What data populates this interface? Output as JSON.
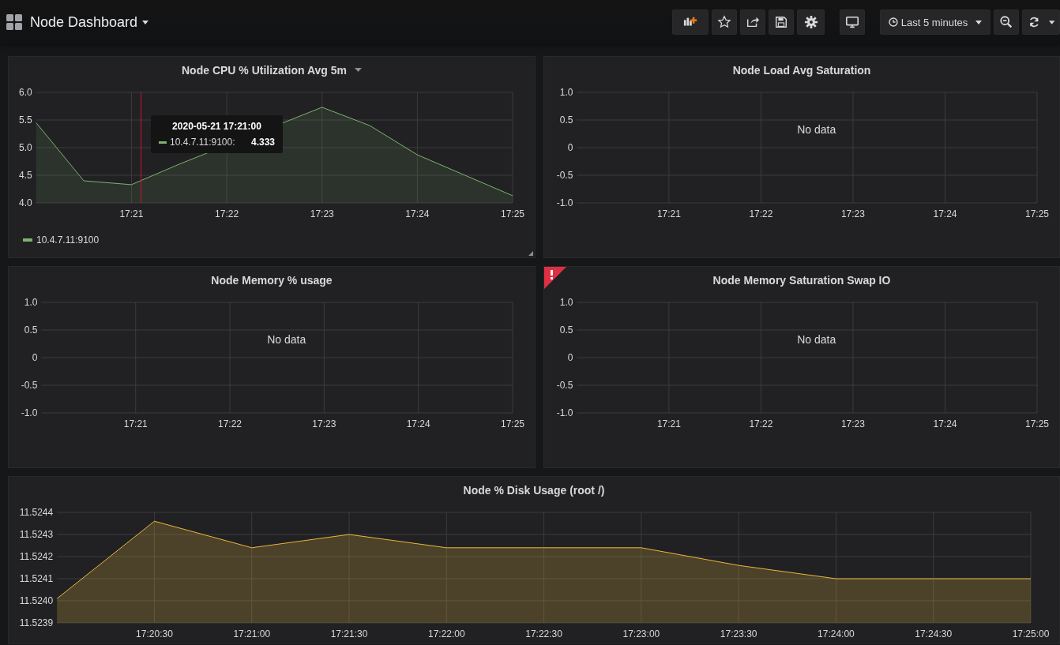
{
  "header": {
    "title": "Node Dashboard",
    "toolbar": [
      {
        "kind": "add-panel"
      },
      {
        "kind": "star"
      },
      {
        "kind": "share"
      },
      {
        "kind": "save"
      },
      {
        "kind": "settings"
      },
      {
        "kind": "tv"
      },
      {
        "kind": "time-picker",
        "label": "Last 5 minutes"
      },
      {
        "kind": "zoom-out"
      },
      {
        "kind": "refresh"
      }
    ]
  },
  "panels": [
    {
      "title": "Node CPU % Utilization Avg 5m",
      "hovered": true,
      "alert": false,
      "tooltip": {
        "time": "2020-05-21 17:21:00",
        "series": "10.4.7.11:9100:",
        "value": "4.333"
      },
      "chart_data": {
        "type": "area",
        "categories": [
          null,
          null,
          "17:21",
          null,
          "17:22",
          null,
          "17:23",
          null,
          "17:24",
          null,
          "17:25"
        ],
        "ylim": [
          4,
          6
        ],
        "yticks": [
          {
            "value": 6,
            "label": "6.0"
          },
          {
            "value": 5.5,
            "label": "5.5"
          },
          {
            "value": 5,
            "label": "5.0"
          },
          {
            "value": 4.5,
            "label": "4.5"
          },
          {
            "value": 4,
            "label": "4.0"
          }
        ],
        "series": [
          {
            "name": "10.4.7.11:9100",
            "color": "#7eb26d",
            "values": [
              5.45,
              4.4,
              4.33,
              4.7,
              null,
              null,
              5.73,
              5.4,
              4.87,
              4.5,
              4.13
            ]
          }
        ],
        "grid": true
      }
    },
    {
      "title": "Node Load Avg Saturation",
      "hovered": false,
      "alert": false,
      "no_data": "No data",
      "chart_data": {
        "type": "line",
        "grid": true,
        "categories": [
          null,
          null,
          "17:21",
          null,
          "17:22",
          null,
          "17:23",
          null,
          "17:24",
          null,
          "17:25"
        ],
        "ylim": [
          -1,
          1
        ],
        "yticks": [
          {
            "value": 1,
            "label": "1.0"
          },
          {
            "value": 0.5,
            "label": "0.5"
          },
          {
            "value": 0,
            "label": "0"
          },
          {
            "value": -0.5,
            "label": "-0.5"
          },
          {
            "value": -1,
            "label": "-1.0"
          }
        ]
      }
    },
    {
      "title": "Node Memory % usage",
      "hovered": false,
      "alert": false,
      "no_data": "No data",
      "chart_data": {
        "type": "line",
        "grid": true,
        "categories": [
          null,
          null,
          "17:21",
          null,
          "17:22",
          null,
          "17:23",
          null,
          "17:24",
          null,
          "17:25"
        ],
        "ylim": [
          -1,
          1
        ],
        "yticks": [
          {
            "value": 1,
            "label": "1.0"
          },
          {
            "value": 0.5,
            "label": "0.5"
          },
          {
            "value": 0,
            "label": "0"
          },
          {
            "value": -0.5,
            "label": "-0.5"
          },
          {
            "value": -1,
            "label": "-1.0"
          }
        ]
      }
    },
    {
      "title": "Node Memory Saturation Swap IO",
      "hovered": false,
      "alert": true,
      "no_data": "No data",
      "chart_data": {
        "type": "line",
        "grid": true,
        "categories": [
          null,
          null,
          "17:21",
          null,
          "17:22",
          null,
          "17:23",
          null,
          "17:24",
          null,
          "17:25"
        ],
        "ylim": [
          -1,
          1
        ],
        "yticks": [
          {
            "value": 1,
            "label": "1.0"
          },
          {
            "value": 0.5,
            "label": "0.5"
          },
          {
            "value": 0,
            "label": "0"
          },
          {
            "value": -0.5,
            "label": "-0.5"
          },
          {
            "value": -1,
            "label": "-1.0"
          }
        ]
      }
    },
    {
      "title": "Node % Disk Usage (root /)",
      "hovered": false,
      "alert": false,
      "chart_data": {
        "type": "area",
        "grid": true,
        "categories": [
          null,
          "17:20:30",
          "17:21:00",
          "17:21:30",
          "17:22:00",
          "17:22:30",
          "17:23:00",
          "17:23:30",
          "17:24:00",
          "17:24:30",
          "17:25:00"
        ],
        "ylim": [
          11.5239,
          11.5244
        ],
        "yticks": [
          {
            "value": 11.5244,
            "label": "11.5244"
          },
          {
            "value": 11.5243,
            "label": "11.5243"
          },
          {
            "value": 11.5242,
            "label": "11.5242"
          },
          {
            "value": 11.5241,
            "label": "11.5241"
          },
          {
            "value": 11.524,
            "label": "11.5240"
          },
          {
            "value": 11.5239,
            "label": "11.5239"
          }
        ],
        "series": [
          {
            "color": "#eab839",
            "values": [
              11.52401,
              11.52436,
              11.52424,
              11.5243,
              11.52424,
              11.52424,
              11.52424,
              11.52416,
              11.5241,
              11.5241,
              11.5241
            ]
          }
        ]
      }
    }
  ]
}
